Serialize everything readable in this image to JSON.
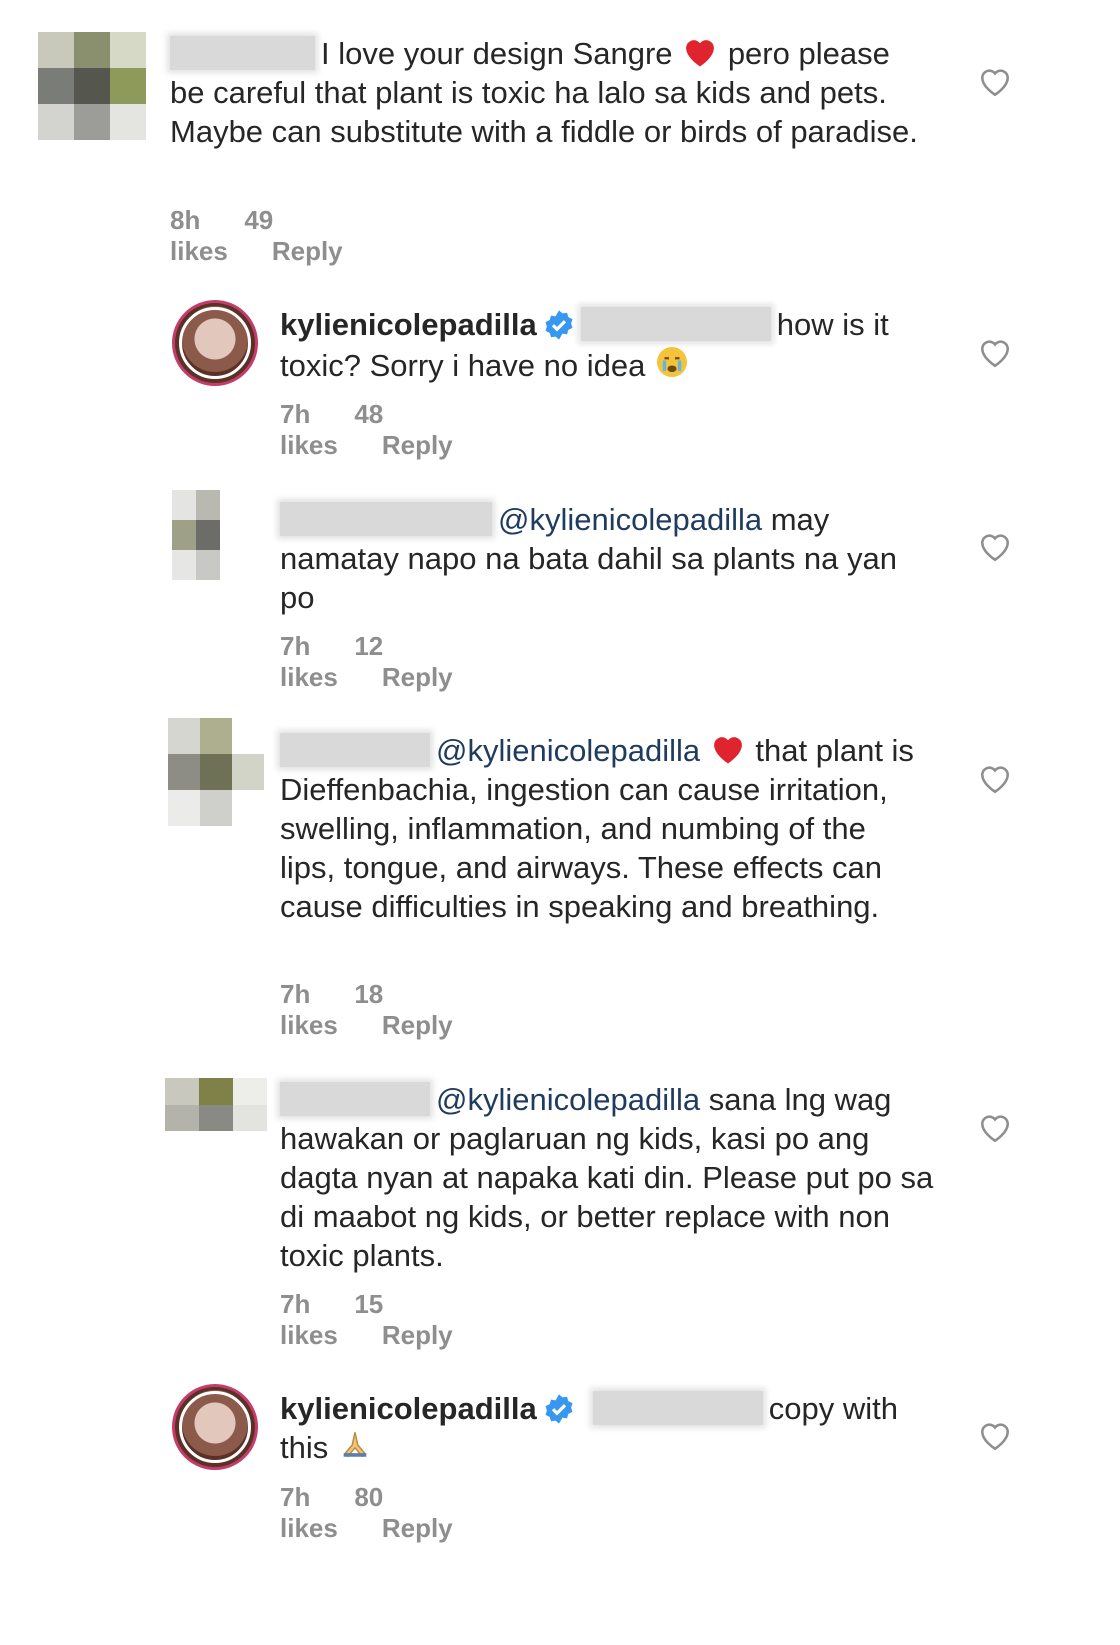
{
  "comments": [
    {
      "text_pre": "I love your design Sangre",
      "text_post": "pero please be careful that plant is toxic ha lalo sa kids and pets. Maybe can substitute with a fiddle or birds of paradise.",
      "time": "8h",
      "likes": "49 likes",
      "reply": "Reply"
    },
    {
      "username": "kylienicolepadilla",
      "text_a": "how is it",
      "text_b": "toxic? Sorry i have no idea",
      "time": "7h",
      "likes": "48 likes",
      "reply": "Reply"
    },
    {
      "mention": "@kylienicolepadilla",
      "text_a": "may",
      "text_b": "namatay napo na bata dahil sa plants na yan",
      "text_c": "po",
      "time": "7h",
      "likes": "12 likes",
      "reply": "Reply"
    },
    {
      "mention": "@kylienicolepadilla",
      "text_a": "that",
      "text_b": "plant is Dieffenbachia, ingestion can cause irritation, swelling, inflammation, and numbing of the lips, tongue, and airways. These effects can cause difficulties in speaking and breathing.",
      "time": "7h",
      "likes": "18 likes",
      "reply": "Reply"
    },
    {
      "mention": "@kylienicolepadilla",
      "text_a": "sana lng wag",
      "text_b": "hawakan or paglaruan ng kids, kasi po ang dagta nyan at napaka kati din. Please put po sa di maabot ng kids, or better replace with non toxic plants.",
      "time": "7h",
      "likes": "15 likes",
      "reply": "Reply"
    },
    {
      "username": "kylienicolepadilla",
      "text_a": "copy with",
      "text_b": "this",
      "time": "7h",
      "likes": "80 likes",
      "reply": "Reply"
    }
  ],
  "icons": {
    "like": "heart-outline-icon",
    "verified": "verified-badge-icon",
    "heart_emoji": "red-heart-emoji",
    "crying_emoji": "crying-face-emoji",
    "pray_emoji": "folded-hands-emoji"
  },
  "colors": {
    "text": "#262626",
    "meta": "#8e8e8e",
    "mention": "#1f3b5e",
    "verified": "#3897f0",
    "heart": "#e0242f"
  }
}
